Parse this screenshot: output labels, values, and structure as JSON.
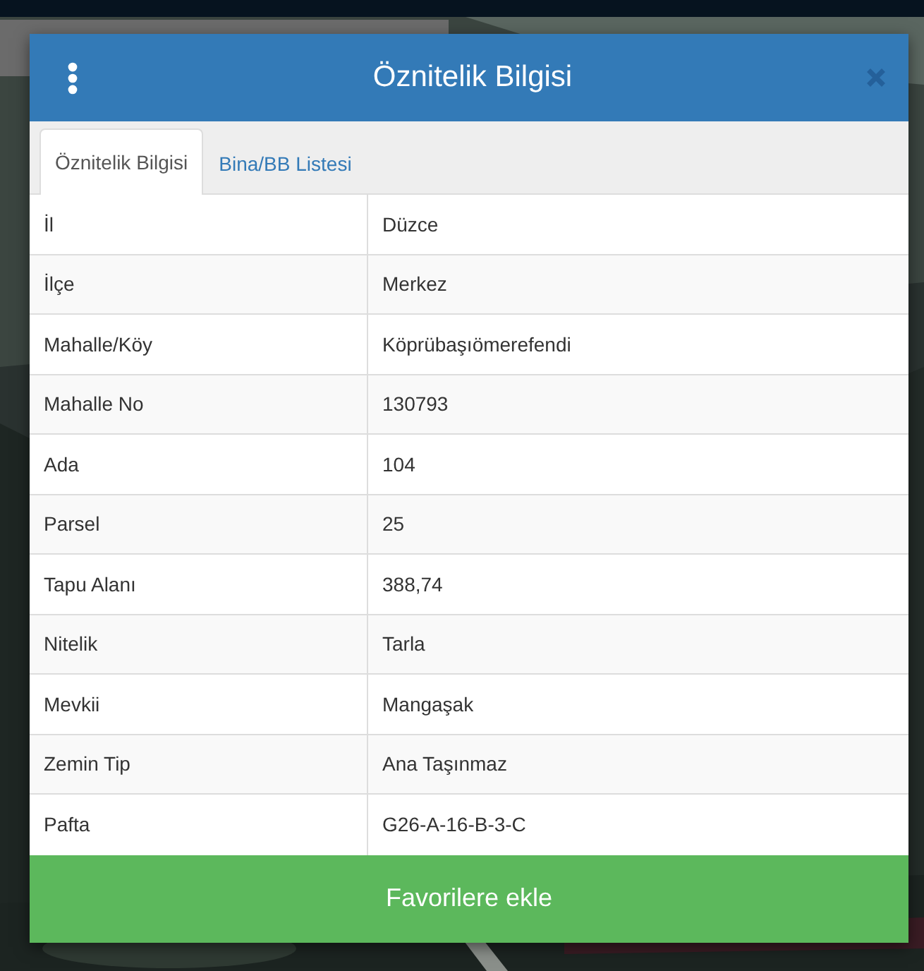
{
  "dialog": {
    "title": "Öznitelik Bilgisi"
  },
  "tabs": [
    {
      "label": "Öznitelik Bilgisi",
      "selected": true
    },
    {
      "label": "Bina/BB Listesi",
      "selected": false
    }
  ],
  "rows": [
    {
      "label": "İl",
      "value": "Düzce"
    },
    {
      "label": "İlçe",
      "value": "Merkez"
    },
    {
      "label": "Mahalle/Köy",
      "value": "Köprübaşıömerefendi"
    },
    {
      "label": "Mahalle No",
      "value": "130793"
    },
    {
      "label": "Ada",
      "value": "104"
    },
    {
      "label": "Parsel",
      "value": "25"
    },
    {
      "label": "Tapu Alanı",
      "value": "388,74"
    },
    {
      "label": "Nitelik",
      "value": "Tarla"
    },
    {
      "label": "Mevkii",
      "value": "Mangaşak"
    },
    {
      "label": "Zemin Tip",
      "value": "Ana Taşınmaz"
    },
    {
      "label": "Pafta",
      "value": "G26-A-16-B-3-C"
    }
  ],
  "action_button": "Favorilere ekle"
}
